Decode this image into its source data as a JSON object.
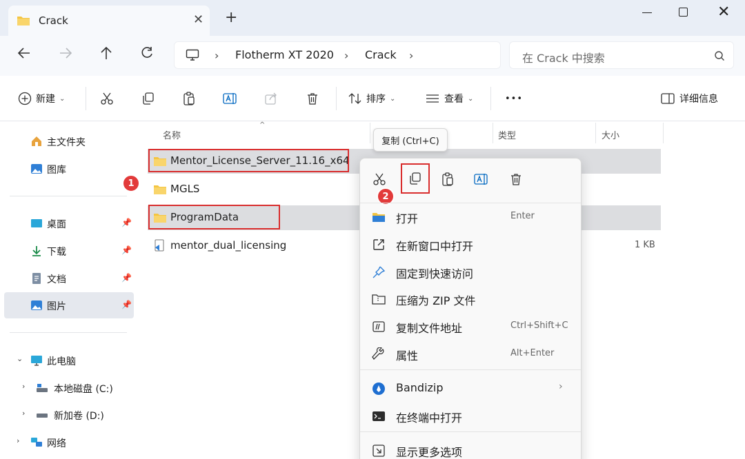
{
  "tab": {
    "title": "Crack",
    "close": "✕",
    "new_tab": "+"
  },
  "window": {
    "minimize": "minimize",
    "maximize": "maximize",
    "close": "✕"
  },
  "nav": {
    "breadcrumb": [
      "Flotherm XT 2020",
      "Crack"
    ],
    "sep": "›",
    "search_placeholder": "在 Crack 中搜索"
  },
  "toolbar": {
    "new_label": "新建",
    "sort_label": "排序",
    "view_label": "查看",
    "more_label": "•••",
    "details_label": "详细信息"
  },
  "sidebar": {
    "home": "主文件夹",
    "gallery": "图库",
    "desktop": "桌面",
    "downloads": "下载",
    "documents": "文档",
    "pictures": "图片",
    "this_pc": "此电脑",
    "drive_c": "本地磁盘 (C:)",
    "drive_d": "新加卷 (D:)",
    "network": "网络",
    "pin": "📌",
    "expand_open": "⌄",
    "expand_closed": "›"
  },
  "columns": {
    "name": "名称",
    "type": "类型",
    "size": "大小",
    "sort_arrow": "^"
  },
  "files": [
    {
      "name": "Mentor_License_Server_11.16_x64",
      "size": ""
    },
    {
      "name": "MGLS",
      "size": ""
    },
    {
      "name": "ProgramData",
      "size": ""
    },
    {
      "name": "mentor_dual_licensing",
      "size": "1 KB"
    }
  ],
  "annotations": {
    "badge1": "1",
    "badge2": "2"
  },
  "tooltip": "复制 (Ctrl+C)",
  "context_menu": {
    "items": [
      {
        "label": "打开",
        "shortcut": "Enter"
      },
      {
        "label": "在新窗口中打开",
        "shortcut": ""
      },
      {
        "label": "固定到快速访问",
        "shortcut": ""
      },
      {
        "label": "压缩为 ZIP 文件",
        "shortcut": ""
      },
      {
        "label": "复制文件地址",
        "shortcut": "Ctrl+Shift+C"
      },
      {
        "label": "属性",
        "shortcut": "Alt+Enter"
      },
      {
        "label": "Bandizip",
        "shortcut": ""
      },
      {
        "label": "在终端中打开",
        "shortcut": ""
      },
      {
        "label": "显示更多选项",
        "shortcut": ""
      }
    ],
    "submenu_arrow": "›"
  },
  "colors": {
    "accent": "#0067c0",
    "folder": "#f4c542",
    "annotation_red": "#d92d2d"
  }
}
